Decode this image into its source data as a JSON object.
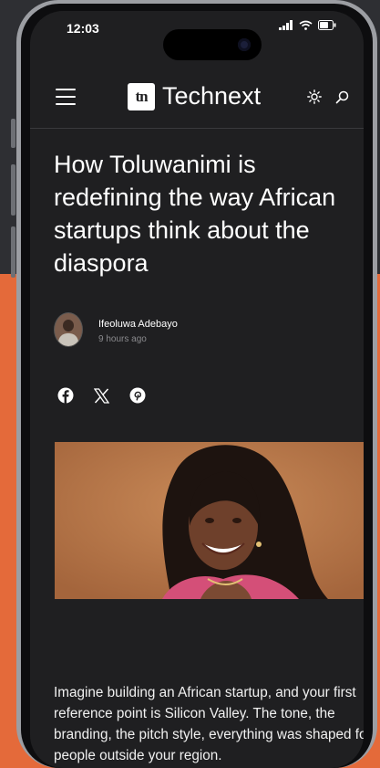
{
  "status_bar": {
    "time": "12:03"
  },
  "header": {
    "logo_mark": "tn",
    "logo_text": "Technext"
  },
  "article": {
    "title": "How Toluwanimi is redefining the way African startups think about the diaspora",
    "author_name": "Ifeoluwa Adebayo",
    "published": "9 hours ago",
    "share_icons": [
      "facebook-icon",
      "x-icon",
      "pinterest-icon"
    ],
    "body": "Imagine building an African startup, and your first reference point is Silicon Valley. The tone, the branding, the pitch style, everything was shaped for people outside your region."
  },
  "colors": {
    "screen_background": "#1f1f21",
    "page_orange": "#e46a3a",
    "hero_background": "#b9774a"
  }
}
